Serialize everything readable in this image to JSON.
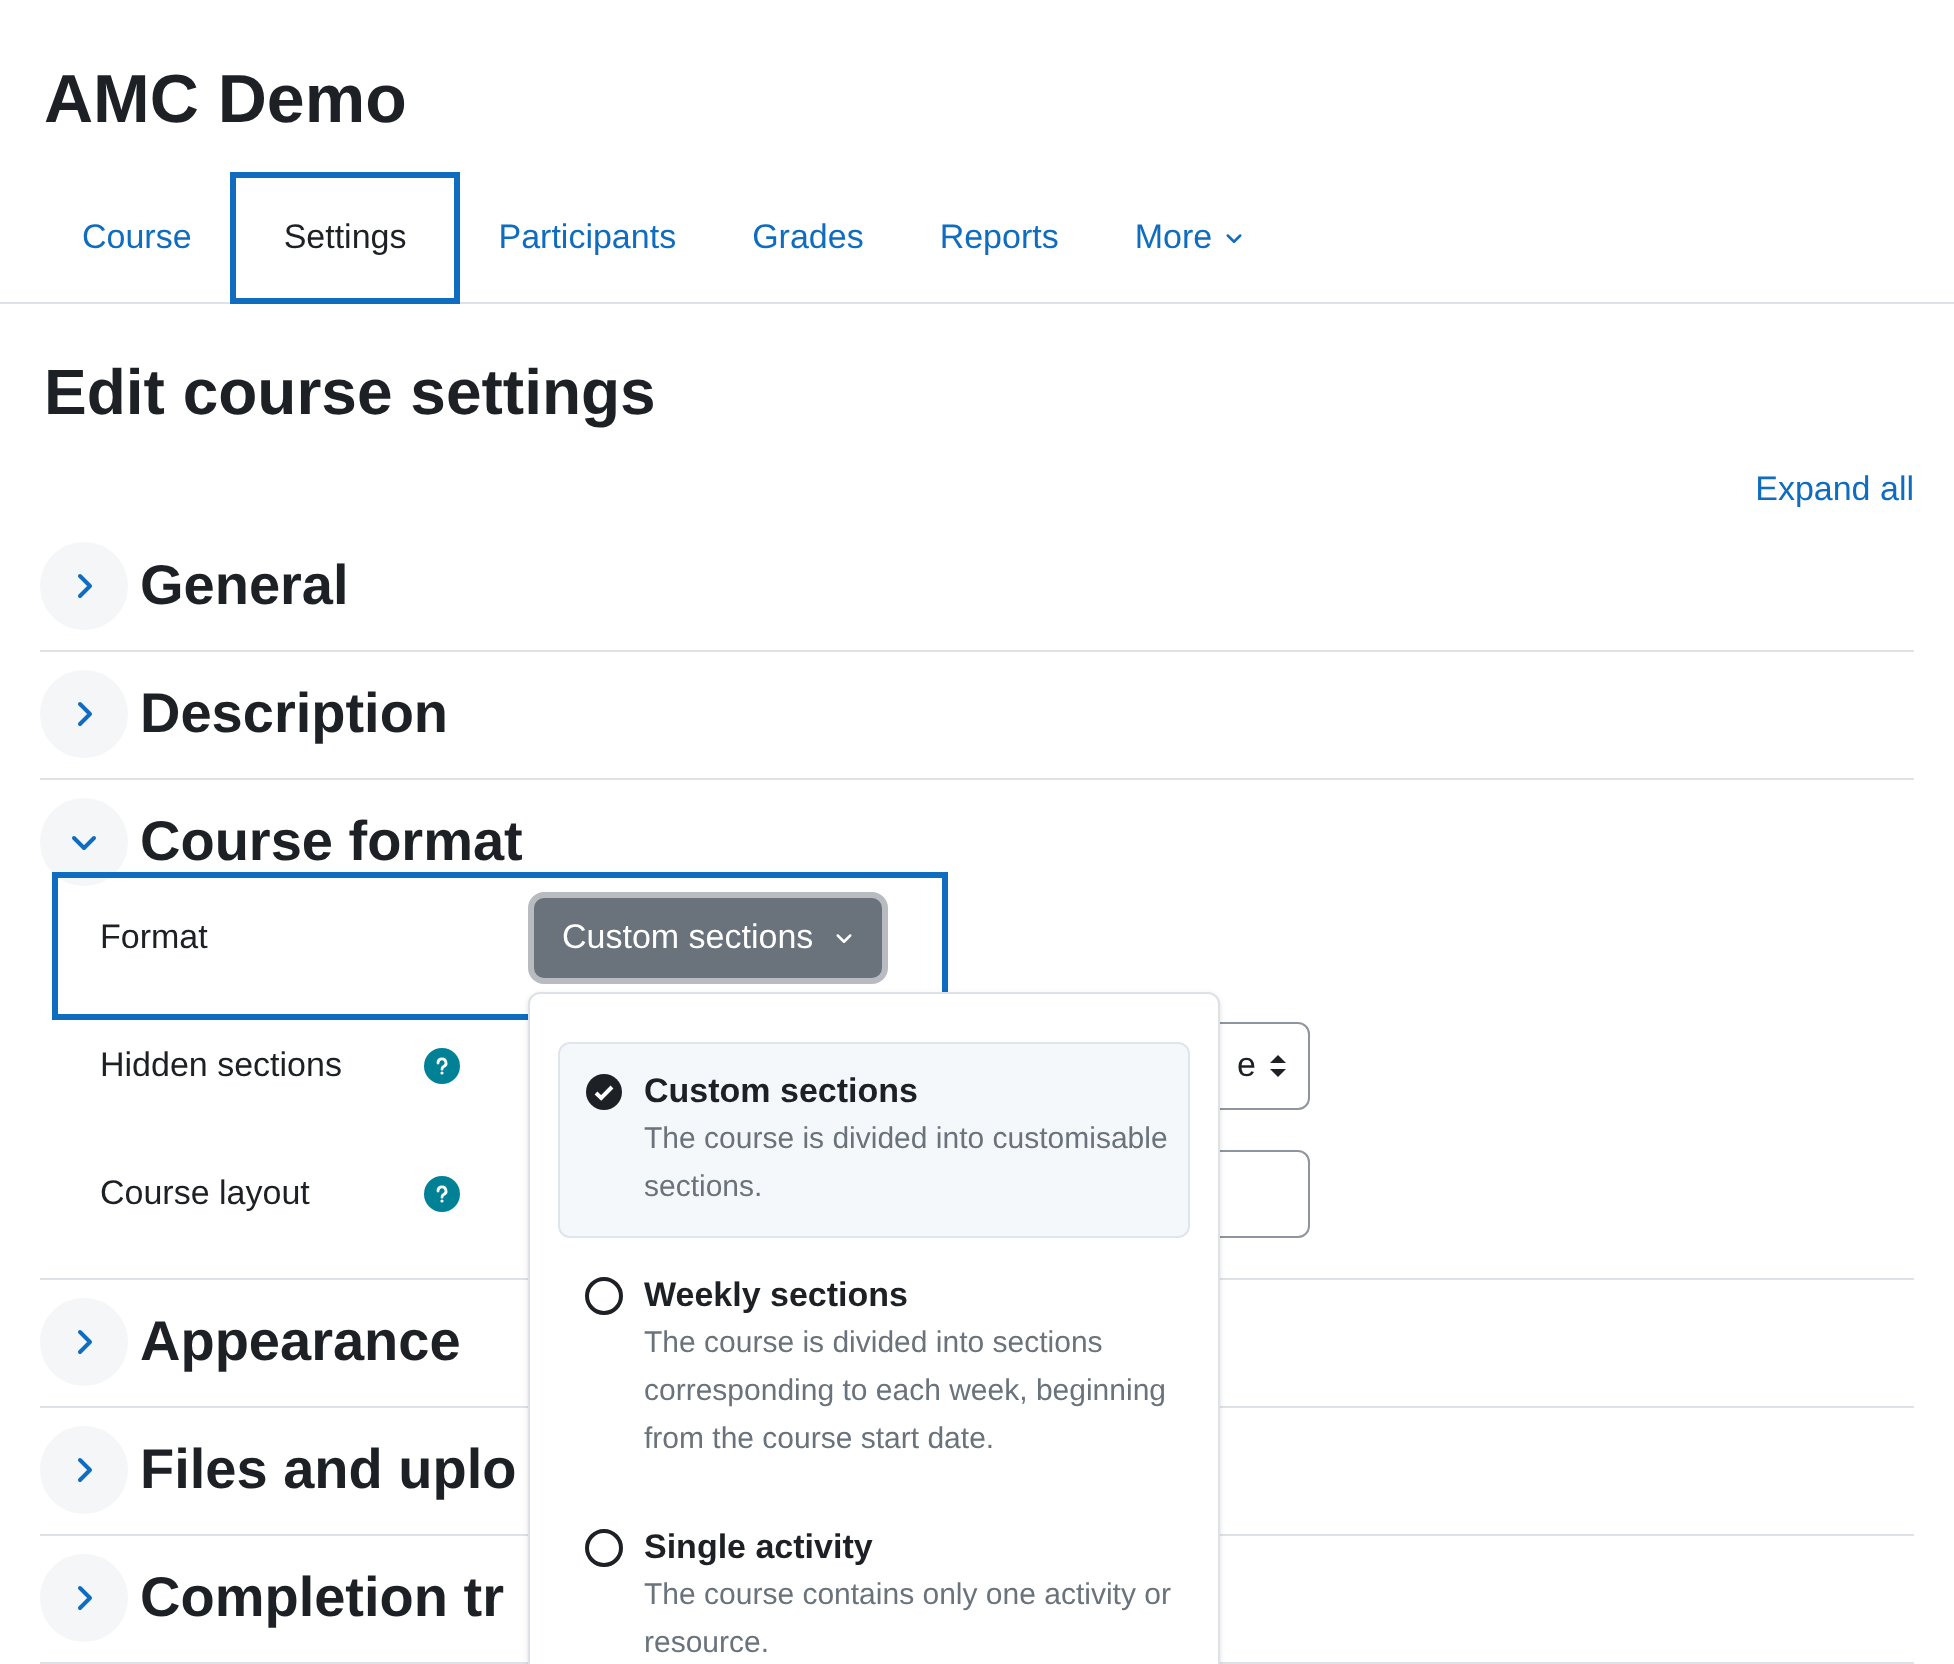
{
  "course_title": "AMC Demo",
  "tabs": [
    {
      "label": "Course",
      "selected": false,
      "highlighted": false,
      "menu": false
    },
    {
      "label": "Settings",
      "selected": true,
      "highlighted": true,
      "menu": false
    },
    {
      "label": "Participants",
      "selected": false,
      "highlighted": false,
      "menu": false
    },
    {
      "label": "Grades",
      "selected": false,
      "highlighted": false,
      "menu": false
    },
    {
      "label": "Reports",
      "selected": false,
      "highlighted": false,
      "menu": false
    },
    {
      "label": "More",
      "selected": false,
      "highlighted": false,
      "menu": true
    }
  ],
  "page_title": "Edit course settings",
  "expand_all": "Expand all",
  "sections": [
    {
      "title": "General",
      "expanded": false
    },
    {
      "title": "Description",
      "expanded": false
    },
    {
      "title": "Course format",
      "expanded": true,
      "fields": [
        {
          "label": "Format",
          "kind": "dropdown",
          "value": "Custom sections",
          "help": false,
          "highlighted": true
        },
        {
          "label": "Hidden sections",
          "kind": "select",
          "value": "e",
          "help": true,
          "highlighted": false
        },
        {
          "label": "Course layout",
          "kind": "select",
          "help": true,
          "highlighted": false
        }
      ]
    },
    {
      "title": "Appearance",
      "expanded": false
    },
    {
      "title": "Files and uplo",
      "expanded": false
    },
    {
      "title": "Completion tr",
      "expanded": false
    }
  ],
  "format_menu": [
    {
      "title": "Custom sections",
      "description": "The course is divided into customisable sections.",
      "selected": true
    },
    {
      "title": "Weekly sections",
      "description": "The course is divided into sections corresponding to each week, beginning from the course start date.",
      "selected": false
    },
    {
      "title": "Single activity",
      "description": "The course contains only one activity or resource.",
      "selected": false
    }
  ]
}
